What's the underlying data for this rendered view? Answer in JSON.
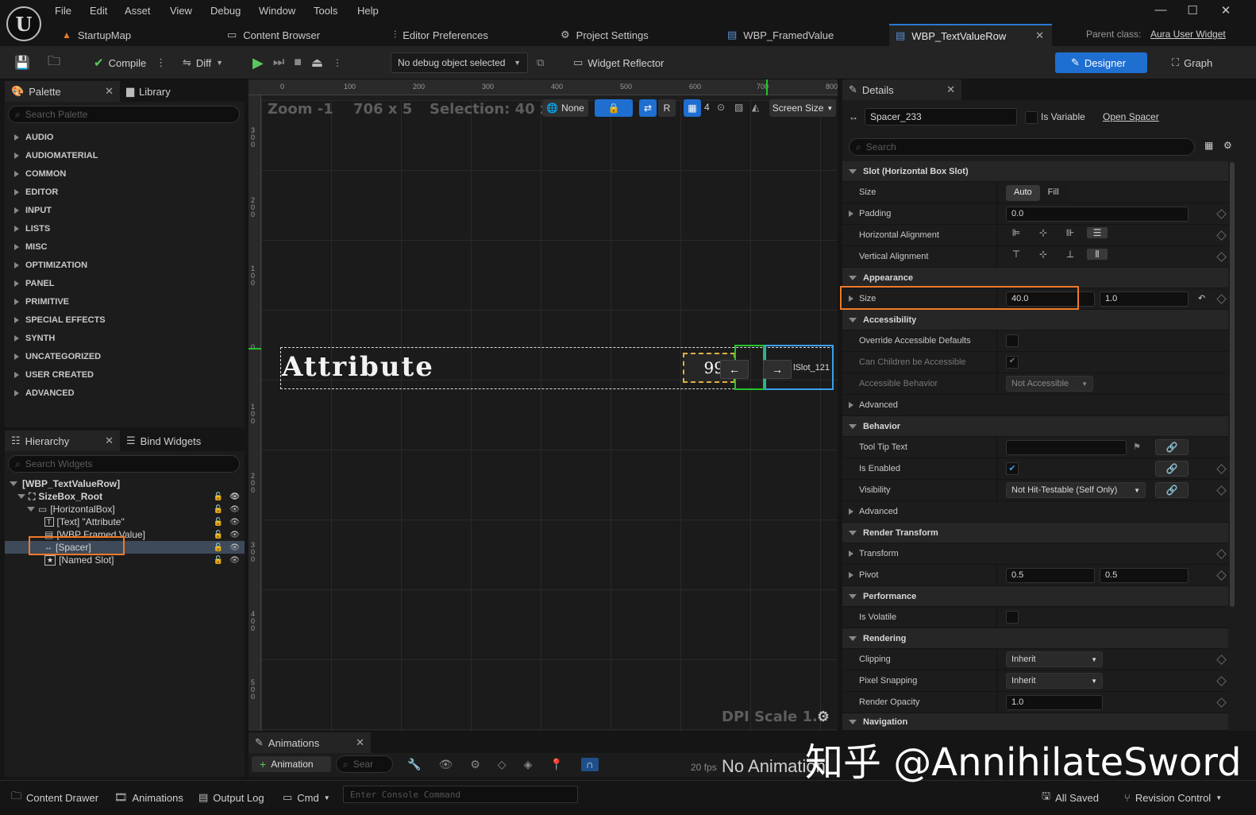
{
  "menu": [
    "File",
    "Edit",
    "Asset",
    "View",
    "Debug",
    "Window",
    "Tools",
    "Help"
  ],
  "tabs": [
    {
      "label": "StartupMap",
      "icon": "level-icon"
    },
    {
      "label": "Content Browser",
      "icon": "folder-icon"
    },
    {
      "label": "Editor Preferences",
      "icon": "sliders-icon"
    },
    {
      "label": "Project Settings",
      "icon": "gear-icon"
    },
    {
      "label": "WBP_FramedValue",
      "icon": "widget-blueprint-icon"
    },
    {
      "label": "WBP_TextValueRow",
      "icon": "widget-blueprint-icon",
      "active": true
    }
  ],
  "parent_class": {
    "label": "Parent class:",
    "value": "Aura User Widget"
  },
  "toolbar": {
    "compile": "Compile",
    "diff": "Diff",
    "debug_object": "No debug object selected",
    "widget_reflector": "Widget Reflector",
    "designer": "Designer",
    "graph": "Graph"
  },
  "palette": {
    "tab": "Palette",
    "library_tab": "Library",
    "search_placeholder": "Search Palette",
    "categories": [
      "AUDIO",
      "AUDIOMATERIAL",
      "COMMON",
      "EDITOR",
      "INPUT",
      "LISTS",
      "MISC",
      "OPTIMIZATION",
      "PANEL",
      "PRIMITIVE",
      "SPECIAL EFFECTS",
      "SYNTH",
      "UNCATEGORIZED",
      "USER CREATED",
      "ADVANCED"
    ]
  },
  "hierarchy": {
    "tab": "Hierarchy",
    "bind_tab": "Bind Widgets",
    "search_placeholder": "Search Widgets",
    "items": [
      {
        "label": "[WBP_TextValueRow]"
      },
      {
        "label": "SizeBox_Root"
      },
      {
        "label": "[HorizontalBox]"
      },
      {
        "label": "[Text] \"Attribute\""
      },
      {
        "label": "[WBP Framed Value]"
      },
      {
        "label": "[Spacer]",
        "selected": true
      },
      {
        "label": "[Named Slot]"
      }
    ]
  },
  "viewport": {
    "zoom": "Zoom -1",
    "size": "706 x 5",
    "selection": "Selection: 40 x 60",
    "none": "None",
    "r": "R",
    "grid_num": "4",
    "screen_size": "Screen Size",
    "dpi": "DPI Scale 1.0",
    "ruler_h": [
      "0",
      "100",
      "200",
      "300",
      "400",
      "500",
      "600",
      "700",
      "800"
    ],
    "ruler_v": [
      "3\n0\n0",
      "2\n0\n0",
      "1\n0\n0",
      "0",
      "1\n0\n0",
      "2\n0\n0",
      "3\n0\n0",
      "4\n0\n0",
      "5\n0\n0"
    ],
    "widget_text": "Attribute",
    "value_text": "99",
    "slot_text": "lSlot_121",
    "left_arrow": "←",
    "right_arrow": "→"
  },
  "details": {
    "tab": "Details",
    "name": "Spacer_233",
    "is_variable": "Is Variable",
    "open_spacer": "Open Spacer",
    "search_placeholder": "Search",
    "slot_section": "Slot (Horizontal Box Slot)",
    "size_label": "Size",
    "auto": "Auto",
    "fill": "Fill",
    "padding_label": "Padding",
    "padding_value": "0.0",
    "h_align": "Horizontal Alignment",
    "v_align": "Vertical Alignment",
    "appearance": "Appearance",
    "app_size_label": "Size",
    "app_size_x": "40.0",
    "app_size_y": "1.0",
    "accessibility": "Accessibility",
    "override_acc": "Override Accessible Defaults",
    "can_children": "Can Children be Accessible",
    "acc_behavior": "Accessible Behavior",
    "not_accessible": "Not Accessible",
    "advanced": "Advanced",
    "behavior": "Behavior",
    "tooltip": "Tool Tip Text",
    "is_enabled": "Is Enabled",
    "visibility": "Visibility",
    "visibility_value": "Not Hit-Testable (Self Only)",
    "advanced2": "Advanced",
    "render_transform": "Render Transform",
    "transform": "Transform",
    "pivot": "Pivot",
    "pivot_x": "0.5",
    "pivot_y": "0.5",
    "performance": "Performance",
    "is_volatile": "Is Volatile",
    "rendering": "Rendering",
    "clipping": "Clipping",
    "clipping_value": "Inherit",
    "pixel_snapping": "Pixel Snapping",
    "pixel_value": "Inherit",
    "render_opacity": "Render Opacity",
    "opacity_value": "1.0",
    "navigation": "Navigation"
  },
  "animations": {
    "tab": "Animations",
    "add": "Animation",
    "search_placeholder": "Sear",
    "fps": "20 fps",
    "none_selected": "No Animation Selected"
  },
  "statusbar": {
    "content_drawer": "Content Drawer",
    "animations": "Animations",
    "output_log": "Output Log",
    "cmd": "Cmd",
    "console_placeholder": "Enter Console Command",
    "all_saved": "All Saved",
    "revision_control": "Revision Control"
  },
  "watermark": "知乎 @AnnihilateSword",
  "colors": {
    "accent": "#1f6fd1",
    "highlight": "#f07a28",
    "selection_green": "#22c42a",
    "selection_blue": "#3aa0e8"
  }
}
